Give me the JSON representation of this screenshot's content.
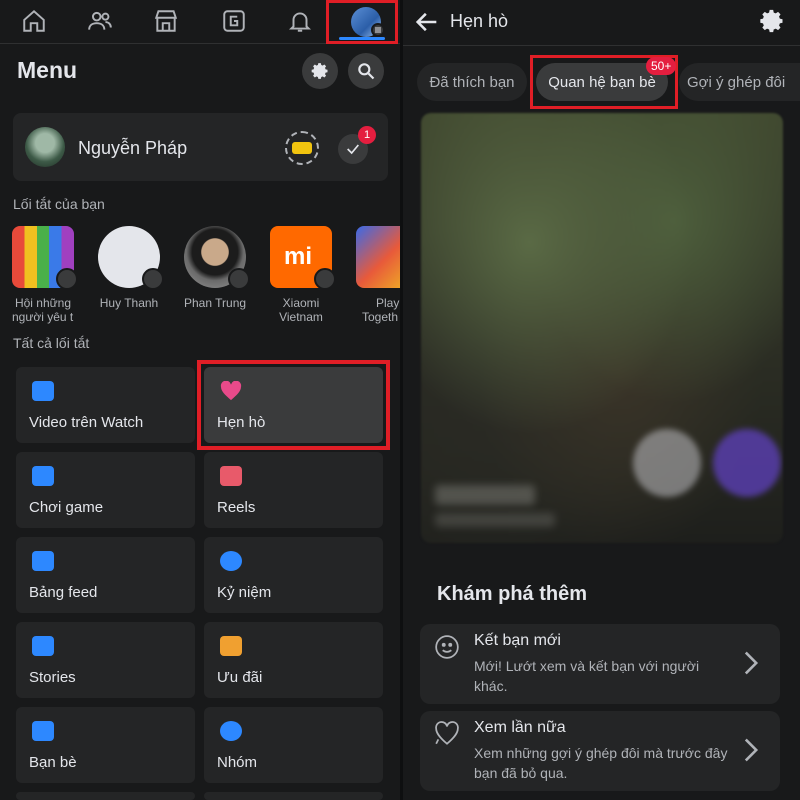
{
  "left": {
    "nav": {
      "items": [
        "home-icon",
        "friends-icon",
        "marketplace-icon",
        "gaming-icon",
        "notifications-icon",
        "menu-profile-icon"
      ]
    },
    "menu_title": "Menu",
    "profile": {
      "name": "Nguyễn Pháp",
      "notification_count": "1"
    },
    "shortcuts_label": "Lối tắt của bạn",
    "shortcuts": [
      {
        "label1": "Hội những",
        "label2": "người yêu t...",
        "color": "#c9a227"
      },
      {
        "label1": "Huy Thanh",
        "label2": "",
        "color": "#e4e6eb"
      },
      {
        "label1": "Phan Trung",
        "label2": "",
        "color": "#8a7a6a"
      },
      {
        "label1": "Xiaomi",
        "label2": "Vietnam",
        "color": "#ff6900"
      },
      {
        "label1": "Play",
        "label2": "Togeth",
        "color": "#d8683a"
      }
    ],
    "all_shortcuts_label": "Tất cả lối tắt",
    "tiles": [
      {
        "label": "Video trên Watch",
        "icon": "watch-icon",
        "color": "#2d88ff"
      },
      {
        "label": "Hẹn hò",
        "icon": "heart-icon",
        "color": "#e84a8a"
      },
      {
        "label": "Chơi game",
        "icon": "gaming-icon",
        "color": "#2d88ff"
      },
      {
        "label": "Reels",
        "icon": "reels-icon",
        "color": "#e85a6a"
      },
      {
        "label": "Bảng feed",
        "icon": "feed-icon",
        "color": "#2d88ff"
      },
      {
        "label": "Kỷ niệm",
        "icon": "memories-icon",
        "color": "#2d88ff"
      },
      {
        "label": "Stories",
        "icon": "stories-icon",
        "color": "#2d88ff"
      },
      {
        "label": "Ưu đãi",
        "icon": "offers-icon",
        "color": "#f0a030"
      },
      {
        "label": "Bạn bè",
        "icon": "friends-icon",
        "color": "#2d88ff"
      },
      {
        "label": "Nhóm",
        "icon": "groups-icon",
        "color": "#2d88ff"
      }
    ]
  },
  "right": {
    "title": "Hẹn hò",
    "pills": [
      "Đã thích bạn",
      "Quan hệ bạn bè",
      "Gợi ý ghép đôi"
    ],
    "pill_badge": "50+",
    "explore_title": "Khám phá thêm",
    "explore": [
      {
        "title": "Kết bạn mới",
        "desc": "Mới! Lướt xem và kết bạn với người khác.",
        "icon": "smile-icon"
      },
      {
        "title": "Xem lần nữa",
        "desc": "Xem những gợi ý ghép đôi mà trước đây bạn đã bỏ qua.",
        "icon": "heart-outline-icon"
      }
    ]
  },
  "colors": {
    "highlight": "#e01e26",
    "accent": "#2d88ff",
    "badge": "#e41e3f"
  }
}
